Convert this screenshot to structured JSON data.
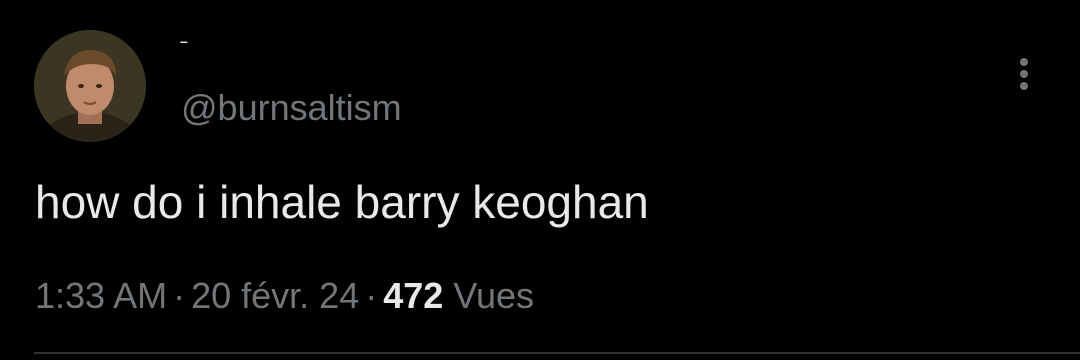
{
  "author": {
    "display_name": "–",
    "handle": "@burnsaltism",
    "avatar": "avatar-photo"
  },
  "tweet": {
    "text": "how do i inhale barry keoghan"
  },
  "meta": {
    "time": "1:33 AM",
    "separator": "·",
    "date": "20 févr. 24",
    "views_count": "472",
    "views_label": "Vues"
  },
  "icons": {
    "more": "more-vertical-icon"
  },
  "colors": {
    "background": "#000000",
    "primary_text": "#e7e9ea",
    "secondary_text": "#71767b",
    "divider": "#2f3336"
  }
}
